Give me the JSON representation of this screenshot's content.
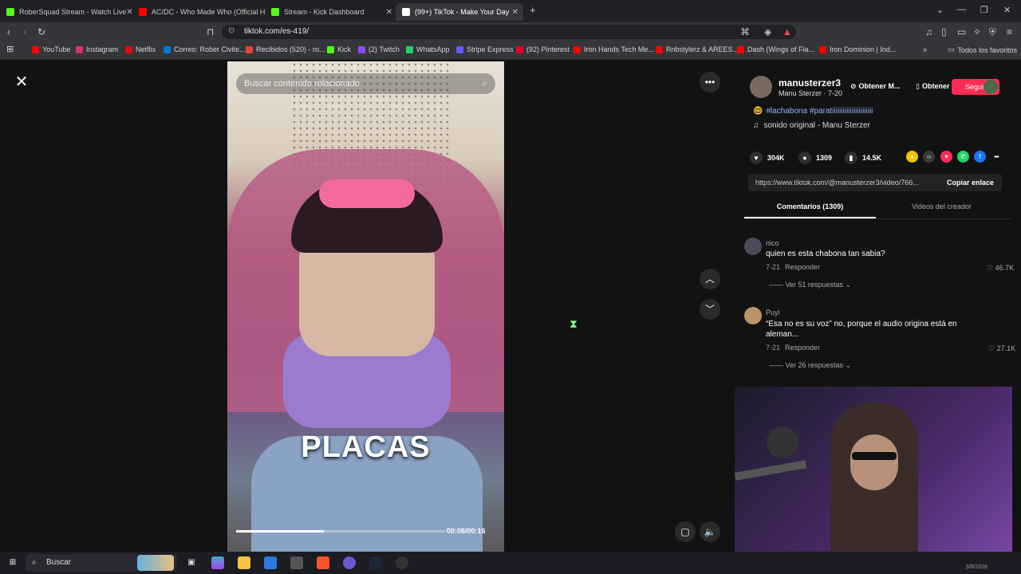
{
  "tabs": [
    {
      "title": "RoberSquad Stream - Watch Live",
      "color": "#53fc18"
    },
    {
      "title": "AC/DC - Who Made Who (Official HD",
      "color": "#ff0000"
    },
    {
      "title": "Stream - Kick Dashboard",
      "color": "#53fc18"
    },
    {
      "title": "(99+) TikTok - Make Your Day",
      "color": "#ffffff"
    }
  ],
  "address": {
    "url": "tiktok.com/es-419/"
  },
  "bookmarks": [
    {
      "label": "YouTube",
      "color": "#ff0000"
    },
    {
      "label": "Instagram",
      "color": "#e1306c"
    },
    {
      "label": "Netflix",
      "color": "#e50914"
    },
    {
      "label": "Correo: Rober Civite...",
      "color": "#0078d4"
    },
    {
      "label": "Recibidos (520) - ro...",
      "color": "#ea4335"
    },
    {
      "label": "Kick",
      "color": "#53fc18"
    },
    {
      "label": "(2) Twitch",
      "color": "#9146ff"
    },
    {
      "label": "WhatsApp",
      "color": "#25d366"
    },
    {
      "label": "Stripe Express",
      "color": "#635bff"
    },
    {
      "label": "(92) Pinterest",
      "color": "#e60023"
    },
    {
      "label": "Iron Hands Tech Me...",
      "color": "#ff0000"
    },
    {
      "label": "Rnbstylerz & AREES...",
      "color": "#ff0000"
    },
    {
      "label": "Dash (Wings of Fla...",
      "color": "#ff0000"
    },
    {
      "label": "Iron Dominion | Ind...",
      "color": "#ff0000"
    }
  ],
  "bookmarks_more": "Todos los favoritos",
  "video": {
    "search_placeholder": "Buscar contenido relacionado",
    "caption": "PLACAS",
    "time": "00:06/00:16",
    "progress": 0.42
  },
  "post": {
    "username": "manusterzer3",
    "subline": "Manu Sterzer · 7-20",
    "btn_a": "Obtener M...",
    "btn_b": "Obtener la ...",
    "follow": "Seguir",
    "hashtags": "#lachabona #paratiiiiiiiiiiiiiiiiiiiiiii",
    "sound": "sonido original - Manu Sterzer",
    "likes": "304K",
    "comments": "1309",
    "saves": "14.5K",
    "link": "https://www.tiktok.com/@manusterzer3/video/766...",
    "copy": "Copiar enlace",
    "tab_comments": "Comentarios (1309)",
    "tab_videos": "Videos del creador"
  },
  "comments": [
    {
      "name": "nico",
      "text": "quien es esta chabona tan sabia?",
      "date": "7-21",
      "reply": "Responder",
      "likes": "46.7K",
      "replies": "Ver 51 respuestas"
    },
    {
      "name": "Puyi",
      "text": "“Esa no es su voz” no, porque el audio origina está en aleman...",
      "date": "7-21",
      "reply": "Responder",
      "likes": "27.1K",
      "replies": "Ver 26 respuestas"
    }
  ],
  "taskbar": {
    "search": "Buscar",
    "date": "3/8/2026"
  }
}
